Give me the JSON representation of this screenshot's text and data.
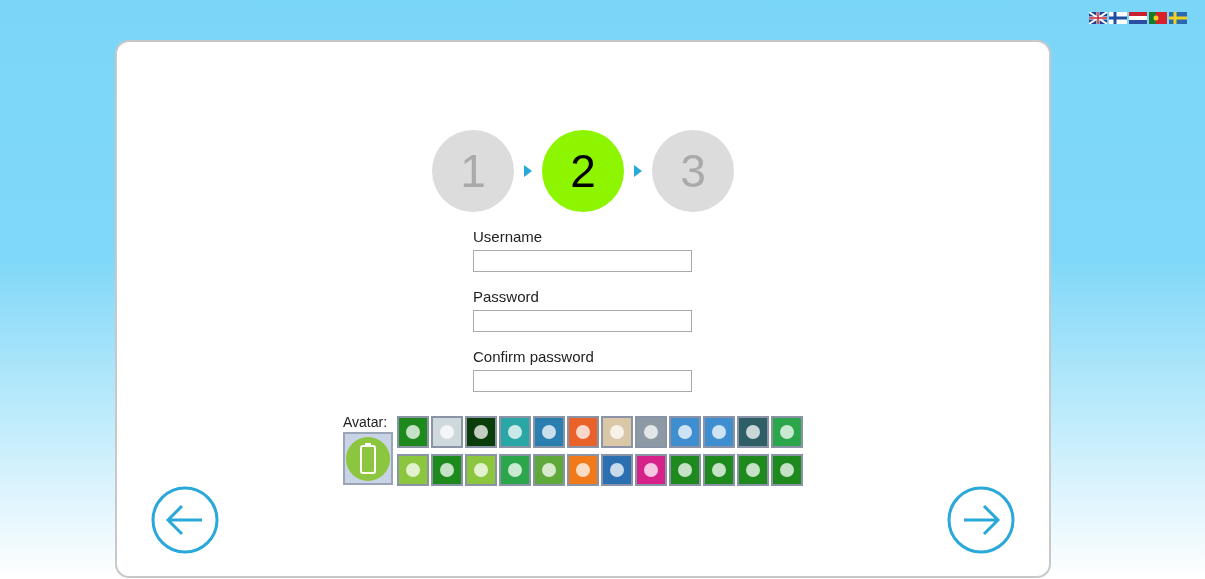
{
  "languages": [
    {
      "kind": "uk"
    },
    {
      "kind": "fi"
    },
    {
      "kind": "nl"
    },
    {
      "kind": "pt"
    },
    {
      "kind": "se"
    }
  ],
  "steps": [
    {
      "label": "1",
      "selected": false
    },
    {
      "label": "2",
      "selected": true
    },
    {
      "label": "3",
      "selected": false
    }
  ],
  "fields": [
    {
      "label": "Username"
    },
    {
      "label": "Password"
    },
    {
      "label": "Confirm password"
    }
  ],
  "avatar": {
    "label": "Avatar:",
    "preview": {
      "color": "#8cc63f"
    },
    "options": [
      {
        "color": "#1e8a1e"
      },
      {
        "color": "#cfd8dc"
      },
      {
        "color": "#0b3d0b"
      },
      {
        "color": "#2aa6a6"
      },
      {
        "color": "#2b7fb0"
      },
      {
        "color": "#e8622a"
      },
      {
        "color": "#d9c7a8"
      },
      {
        "color": "#8d9aa6"
      },
      {
        "color": "#3f8fd0"
      },
      {
        "color": "#3f8fd0"
      },
      {
        "color": "#2f5f66"
      },
      {
        "color": "#2ba64a"
      },
      {
        "color": "#8cc63f"
      },
      {
        "color": "#1e8a1e"
      },
      {
        "color": "#8cc63f"
      },
      {
        "color": "#2ba64a"
      },
      {
        "color": "#5fa83a"
      },
      {
        "color": "#f07a1a"
      },
      {
        "color": "#2b6fb0"
      },
      {
        "color": "#d6208a"
      },
      {
        "color": "#1e8a1e"
      },
      {
        "color": "#1e8a1e"
      },
      {
        "color": "#1e8a1e"
      },
      {
        "color": "#1e8a1e"
      }
    ]
  }
}
